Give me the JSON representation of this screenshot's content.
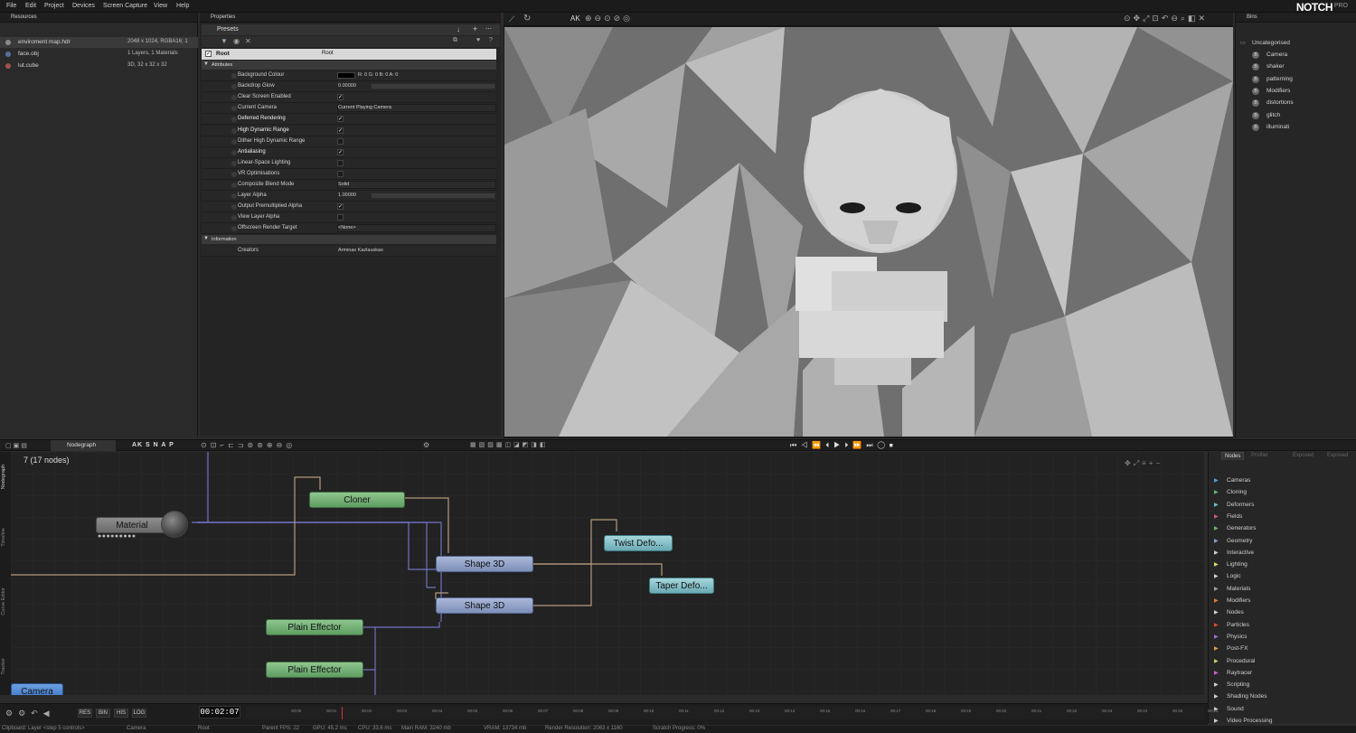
{
  "menu": [
    "File",
    "Edit",
    "Project",
    "Devices",
    "Screen Capture",
    "View",
    "Help"
  ],
  "logo": "NOTCH",
  "logo_pro": "PRO",
  "resources": {
    "title": "Resources",
    "items": [
      {
        "name": "enviroment map.hdr",
        "info": "2048 x 1024, RGBA16; 1"
      },
      {
        "name": "face.obj",
        "info": "1 Layers, 1 Materials"
      },
      {
        "name": "lut.cube",
        "info": "3D, 32 x 32 x 32"
      }
    ]
  },
  "properties": {
    "title": "Properties",
    "presets": "Presets",
    "root_label": "Root",
    "root_value": "Root",
    "attributes": "Attributes",
    "background_value": "R: 0  G: 0  B: 0  A: 0",
    "rows": [
      {
        "label": "Background Colour"
      },
      {
        "label": "Backdrop Glow",
        "value": "0.00000"
      },
      {
        "label": "Clear Screen Enabled",
        "check": "✓"
      },
      {
        "label": "Current Camera",
        "value": "Current Playing Camera"
      },
      {
        "label": "Deferred Rendering",
        "check": "✓",
        "bold": true
      },
      {
        "label": "High Dynamic Range",
        "check": "✓",
        "bold": true
      },
      {
        "label": "Dither High Dynamic Range",
        "check": ""
      },
      {
        "label": "Antialiasing",
        "check": "✓",
        "bold": true
      },
      {
        "label": "Linear-Space Lighting",
        "check": ""
      },
      {
        "label": "VR Optimisations",
        "check": ""
      },
      {
        "label": "Composite Blend Mode",
        "value": "Solid"
      },
      {
        "label": "Layer Alpha",
        "value": "1.00000"
      },
      {
        "label": "Output Premultiplied Alpha",
        "check": "✓"
      },
      {
        "label": "View Layer Alpha",
        "check": ""
      },
      {
        "label": "Offscreen Render Target",
        "value": "<None>"
      }
    ],
    "information": "Information",
    "creators_label": "Creators",
    "creators_value": "Arminas Kazlauskas"
  },
  "bins": {
    "title": "Bins",
    "root": "Uncategorised",
    "items": [
      "Camera",
      "shaker",
      "patterning",
      "Modifiers",
      "distortions",
      "glitch",
      "illuminati"
    ]
  },
  "nodegraph": {
    "tab": "Nodegraph",
    "tools": "AK S N A P",
    "count": "7  (17  nodes)",
    "side_tabs": [
      "Nodegraph",
      "Timeline",
      "Curve Editor",
      "Tracker"
    ],
    "nodes": {
      "material": "Material",
      "cloner": "Cloner",
      "shape1": "Shape  3D",
      "shape2": "Shape  3D",
      "twist": "Twist  Defo...",
      "taper": "Taper  Defo...",
      "plain1": "Plain  Effector",
      "plain2": "Plain  Effector",
      "camera": "Camera"
    }
  },
  "library": {
    "tabs": [
      "Nodes",
      "Profiler",
      "Exposed",
      "Exposed"
    ],
    "items": [
      {
        "label": "Cameras",
        "color": "#4fa3e0"
      },
      {
        "label": "Cloning",
        "color": "#6ab86a"
      },
      {
        "label": "Deformers",
        "color": "#6cc0cc"
      },
      {
        "label": "Fields",
        "color": "#d05a7a"
      },
      {
        "label": "Generators",
        "color": "#6ab86a"
      },
      {
        "label": "Geometry",
        "color": "#8aa0d0"
      },
      {
        "label": "Interactive",
        "color": "#d0d0d0"
      },
      {
        "label": "Lighting",
        "color": "#e0e060"
      },
      {
        "label": "Logic",
        "color": "#d0d0d0"
      },
      {
        "label": "Materials",
        "color": "#a0a0a0"
      },
      {
        "label": "Modifiers",
        "color": "#e08030"
      },
      {
        "label": "Nodes",
        "color": "#d0d0d0"
      },
      {
        "label": "Particles",
        "color": "#e05030"
      },
      {
        "label": "Physics",
        "color": "#a070d0"
      },
      {
        "label": "Post-FX",
        "color": "#e0a040"
      },
      {
        "label": "Procedural",
        "color": "#d0d060"
      },
      {
        "label": "Raytracer",
        "color": "#d060d0"
      },
      {
        "label": "Scripting",
        "color": "#d0d0d0"
      },
      {
        "label": "Shading Nodes",
        "color": "#d0d0d0"
      },
      {
        "label": "Sound",
        "color": "#d0d0d0"
      },
      {
        "label": "Video Processing",
        "color": "#d0d0d0"
      }
    ]
  },
  "timeline": {
    "timecode": "00:02:07",
    "buttons": [
      "RES",
      "BIN",
      "HIS",
      "LOG"
    ],
    "ticks": [
      "00:00",
      "00:01",
      "00:02",
      "00:03",
      "00:04",
      "00:05",
      "00:06",
      "00:07",
      "00:08",
      "00:09",
      "00:10",
      "00:11",
      "00:12",
      "00:13",
      "00:14",
      "00:15",
      "00:16",
      "00:17",
      "00:18",
      "00:19",
      "00:20",
      "00:21",
      "00:22",
      "00:23",
      "00:24",
      "00:25",
      "00:26"
    ]
  },
  "status": [
    "Clipboard: Layer <step 5 controls>",
    "Camera",
    "Root",
    "Parent FPS: 22",
    "GPU: 45.2 ms",
    "CPU: 33.6 ms",
    "Main RAM: 3240 mb",
    "VRAM: 13734 mb",
    "Render Resolution: 2063 x 1160",
    "Scratch Progress: 0%"
  ]
}
